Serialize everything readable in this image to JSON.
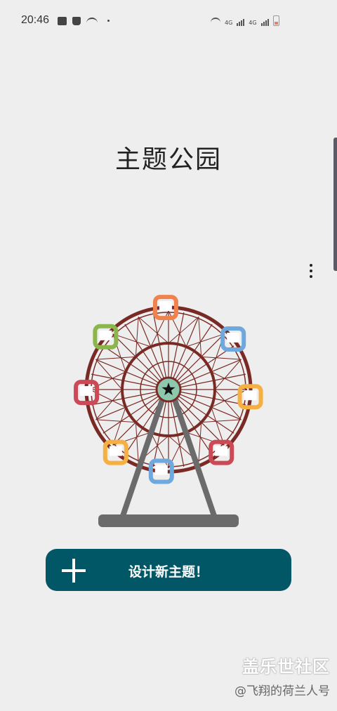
{
  "status_bar": {
    "time": "20:46",
    "network_1": "4G",
    "network_2": "4G"
  },
  "header": {
    "title": "主题公园"
  },
  "illustration": {
    "name": "ferris-wheel",
    "colors": {
      "rim": "#7a2a25",
      "hub": "#8dc8ad",
      "stand": "#6b6b6b",
      "cabins": [
        "#f0824e",
        "#6ea8dd",
        "#f6b042",
        "#cc4a55",
        "#6ea8dd",
        "#f6b042",
        "#cc4a55",
        "#8ab64a"
      ]
    }
  },
  "actions": {
    "create_label": "设计新主题！",
    "create_icon": "plus-icon",
    "more_icon": "more-vert-icon"
  },
  "watermark": {
    "line1": "盖乐世社区",
    "line2": "@飞翔的荷兰人号"
  },
  "theme": {
    "background": "#eeeeee",
    "accent": "#025767"
  }
}
